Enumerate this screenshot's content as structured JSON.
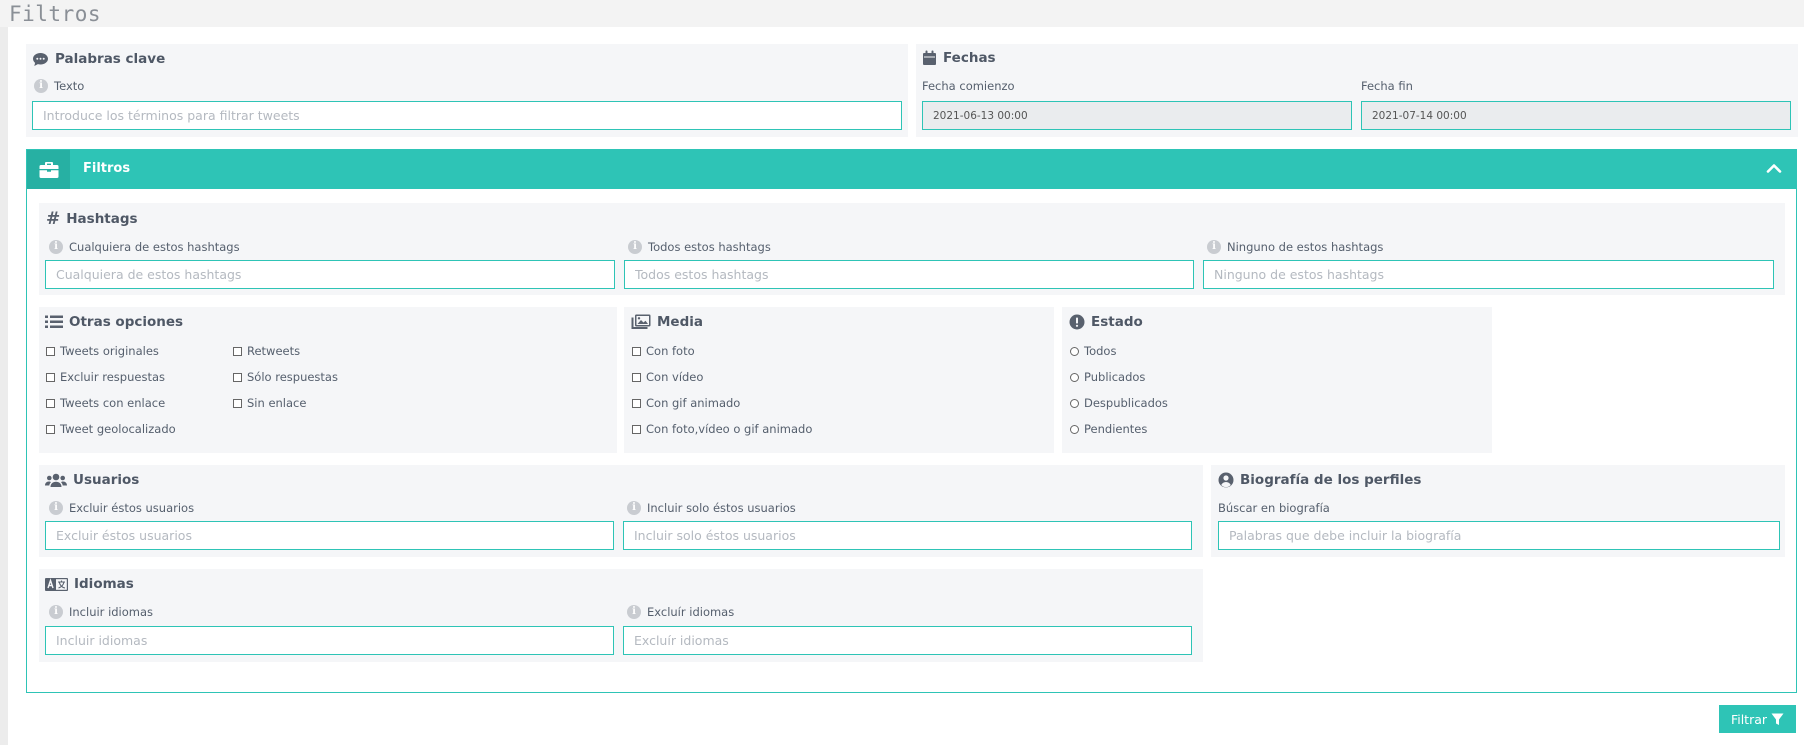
{
  "page": {
    "title": "Filtros"
  },
  "keywords": {
    "title": "Palabras clave",
    "label": "Texto",
    "placeholder": "Introduce los términos para filtrar tweets"
  },
  "dates": {
    "title": "Fechas",
    "start_label": "Fecha comienzo",
    "start_value": "2021-06-13 00:00",
    "end_label": "Fecha fin",
    "end_value": "2021-07-14 00:00"
  },
  "filters_panel": {
    "title": "Filtros",
    "expanded": true
  },
  "hashtags": {
    "title": "Hashtags",
    "fields": [
      {
        "label": "Cualquiera de estos hashtags",
        "placeholder": "Cualquiera de estos hashtags"
      },
      {
        "label": "Todos estos hashtags",
        "placeholder": "Todos estos hashtags"
      },
      {
        "label": "Ninguno de estos hashtags",
        "placeholder": "Ninguno de estos hashtags"
      }
    ]
  },
  "other_options": {
    "title": "Otras opciones",
    "items": [
      "Tweets originales",
      "Retweets",
      "Excluir respuestas",
      "Sólo respuestas",
      "Tweets con enlace",
      "Sin enlace",
      "Tweet geolocalizado"
    ]
  },
  "media": {
    "title": "Media",
    "items": [
      "Con foto",
      "Con vídeo",
      "Con gif animado",
      "Con foto,vídeo o gif animado"
    ]
  },
  "status": {
    "title": "Estado",
    "items": [
      "Todos",
      "Publicados",
      "Despublicados",
      "Pendientes"
    ]
  },
  "users": {
    "title": "Usuarios",
    "fields": [
      {
        "label": "Excluir éstos usuarios",
        "placeholder": "Excluir éstos usuarios"
      },
      {
        "label": "Incluir solo éstos usuarios",
        "placeholder": "Incluir solo éstos usuarios"
      }
    ]
  },
  "bio": {
    "title": "Biografía de los perfiles",
    "label": "Búscar en biografía",
    "placeholder": "Palabras que debe incluir la biografía"
  },
  "languages": {
    "title": "Idiomas",
    "fields": [
      {
        "label": "Incluir idiomas",
        "placeholder": "Incluir idiomas"
      },
      {
        "label": "Excluír idiomas",
        "placeholder": "Excluír idiomas"
      }
    ]
  },
  "actions": {
    "filter_label": "Filtrar"
  },
  "colors": {
    "accent": "#2ec4b6",
    "accent_dark": "#27b0a3",
    "card_bg": "#f5f6f8"
  }
}
